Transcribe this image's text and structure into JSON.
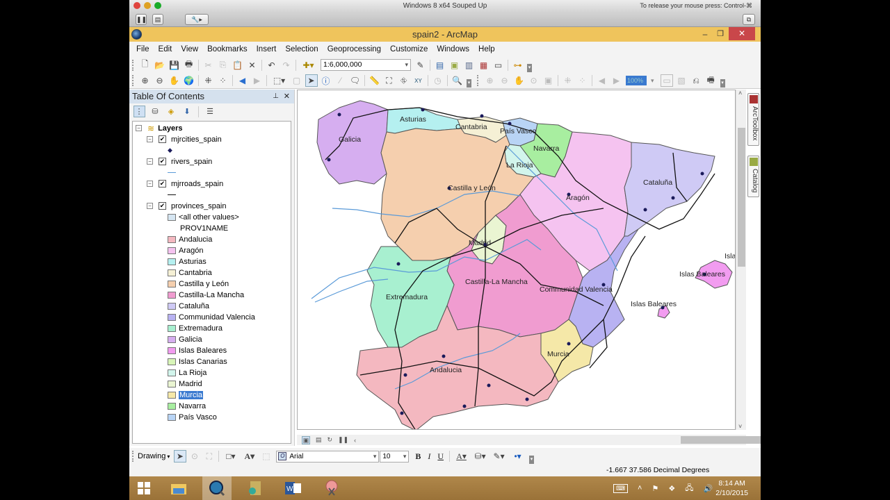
{
  "host": {
    "vm_title": "Windows 8 x64 Souped Up",
    "release_hint": "To release your mouse press: Control-⌘"
  },
  "app": {
    "title": "spain2 - ArcMap",
    "minimize": "–",
    "restore": "❐",
    "close": "✕"
  },
  "menu": [
    "File",
    "Edit",
    "View",
    "Bookmarks",
    "Insert",
    "Selection",
    "Geoprocessing",
    "Customize",
    "Windows",
    "Help"
  ],
  "standard_toolbar": {
    "scale": "1:6,000,000"
  },
  "tools_toolbar": {
    "layout_zoom_percent": "100%"
  },
  "toc": {
    "title": "Table Of Contents",
    "pin": "ᵖ",
    "close": "✕",
    "root": "Layers",
    "layers": [
      {
        "name": "mjrcities_spain",
        "checked": true
      },
      {
        "name": "rivers_spain",
        "checked": true
      },
      {
        "name": "mjrroads_spain",
        "checked": true
      },
      {
        "name": "provinces_spain",
        "checked": true
      }
    ],
    "other_values": "<all other values>",
    "field_name": "PROV1NAME",
    "classes": [
      {
        "label": "Andalucia",
        "color": "#f4b8c0"
      },
      {
        "label": "Aragón",
        "color": "#f5c3f0"
      },
      {
        "label": "Asturias",
        "color": "#b5f0f0"
      },
      {
        "label": "Cantabria",
        "color": "#f5f0d5"
      },
      {
        "label": "Castilla y León",
        "color": "#f5cfae"
      },
      {
        "label": "Castilla-La Mancha",
        "color": "#f09cd0"
      },
      {
        "label": "Cataluña",
        "color": "#cfcaf5"
      },
      {
        "label": "Communidad Valencia",
        "color": "#b8b2f2"
      },
      {
        "label": "Extremadura",
        "color": "#a8f0d0"
      },
      {
        "label": "Galicia",
        "color": "#d6aef0"
      },
      {
        "label": "Islas Baleares",
        "color": "#f29cf0"
      },
      {
        "label": "Islas Canarias",
        "color": "#d8f5b8"
      },
      {
        "label": "La Rioja",
        "color": "#d2f5ec"
      },
      {
        "label": "Madrid",
        "color": "#eaf5d2"
      },
      {
        "label": "Murcia",
        "color": "#f5e8a8",
        "selected": true
      },
      {
        "label": "Navarra",
        "color": "#a8eea0"
      },
      {
        "label": "País Vasco",
        "color": "#b8d4f5"
      }
    ]
  },
  "map": {
    "labels": [
      {
        "text": "Galicia"
      },
      {
        "text": "Asturias"
      },
      {
        "text": "Cantabria"
      },
      {
        "text": "País Vasco"
      },
      {
        "text": "Navarra"
      },
      {
        "text": "La Rioja"
      },
      {
        "text": "Castilla y León"
      },
      {
        "text": "Cataluña"
      },
      {
        "text": "Aragón"
      },
      {
        "text": "Madrid"
      },
      {
        "text": "Extremadura"
      },
      {
        "text": "Castilla-La Mancha"
      },
      {
        "text": "Communidad Valencia"
      },
      {
        "text": "Islas Baleares"
      },
      {
        "text": "Islas Baleares"
      },
      {
        "text": "Isla"
      },
      {
        "text": "Murcia"
      },
      {
        "text": "Andalucia"
      }
    ]
  },
  "side_tabs": [
    "ArcToolbox",
    "Catalog"
  ],
  "drawing": {
    "label": "Drawing",
    "font": "Arial",
    "size": "10",
    "bold": "B",
    "italic": "I",
    "underline": "U"
  },
  "status": {
    "coords": "-1.667  37.586 Decimal Degrees"
  },
  "taskbar": {
    "time": "8:14 AM",
    "date": "2/10/2015"
  }
}
